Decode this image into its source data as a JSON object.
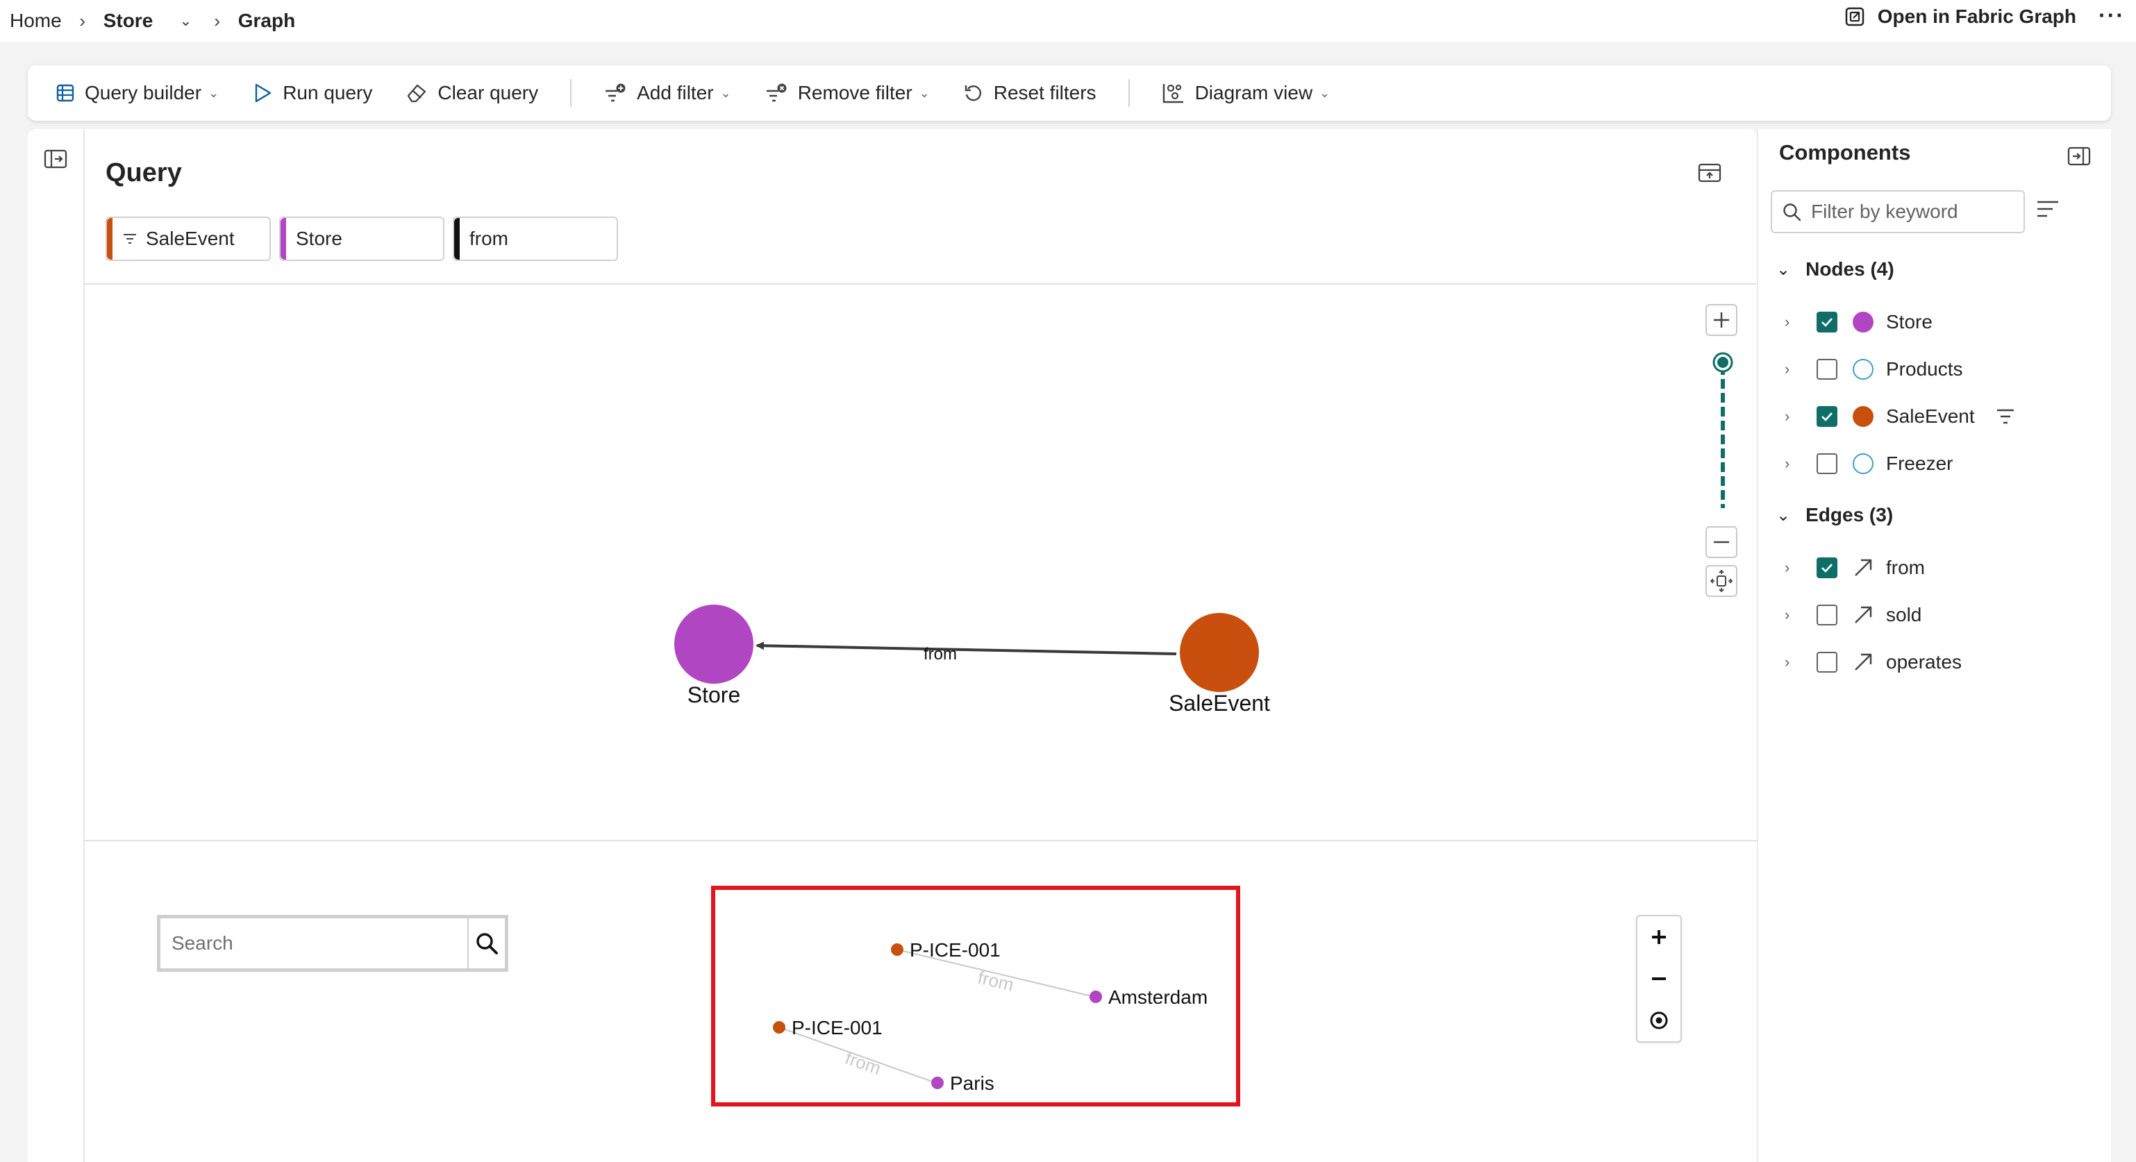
{
  "breadcrumb": {
    "home": "Home",
    "store": "Store",
    "graph": "Graph"
  },
  "header": {
    "open_fabric": "Open in Fabric Graph",
    "more": "···"
  },
  "toolbar": {
    "query_builder": "Query builder",
    "run_query": "Run query",
    "clear_query": "Clear query",
    "add_filter": "Add filter",
    "remove_filter": "Remove filter",
    "reset_filters": "Reset filters",
    "diagram_view": "Diagram view"
  },
  "query": {
    "title": "Query",
    "chips": [
      {
        "label": "SaleEvent",
        "color": "#c94f0f",
        "filtered": true
      },
      {
        "label": "Store",
        "color": "#b146c2",
        "filtered": false
      },
      {
        "label": "from",
        "color": "#111111",
        "filtered": false
      }
    ]
  },
  "diagram": {
    "nodes": [
      {
        "label": "Store",
        "color": "#b146c2"
      },
      {
        "label": "SaleEvent",
        "color": "#c94f0f"
      }
    ],
    "edge_label": "from",
    "zoom_level": 0.95
  },
  "results": {
    "search_placeholder": "Search",
    "rows": [
      {
        "source": "P-ICE-001",
        "edge": "from",
        "target": "Amsterdam"
      },
      {
        "source": "P-ICE-001",
        "edge": "from",
        "target": "Paris"
      }
    ],
    "source_color": "#c94f0f",
    "target_color": "#b146c2",
    "highlight_color": "#e3141d"
  },
  "components": {
    "title": "Components",
    "filter_placeholder": "Filter by keyword",
    "nodes_header": "Nodes (4)",
    "edges_header": "Edges (3)",
    "nodes": [
      {
        "label": "Store",
        "checked": true,
        "color": "#b146c2",
        "filled": true
      },
      {
        "label": "Products",
        "checked": false,
        "color": "#3aa0c8",
        "filled": false
      },
      {
        "label": "SaleEvent",
        "checked": true,
        "color": "#c94f0f",
        "filled": true,
        "filtered": true
      },
      {
        "label": "Freezer",
        "checked": false,
        "color": "#3aa0c8",
        "filled": false
      }
    ],
    "edges": [
      {
        "label": "from",
        "checked": true
      },
      {
        "label": "sold",
        "checked": false
      },
      {
        "label": "operates",
        "checked": false
      }
    ]
  },
  "accent_color": "#0f6f68"
}
